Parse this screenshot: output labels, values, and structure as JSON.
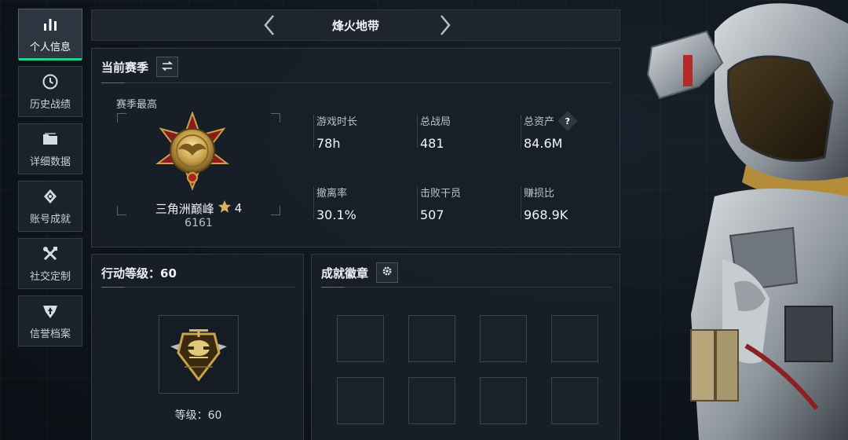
{
  "sidebar": {
    "items": [
      {
        "label": "个人信息",
        "icon": "bar-chart-icon",
        "active": true
      },
      {
        "label": "历史战绩",
        "icon": "clock-icon",
        "active": false
      },
      {
        "label": "详细数据",
        "icon": "folder-icon",
        "active": false
      },
      {
        "label": "账号成就",
        "icon": "diamond-badge-icon",
        "active": false
      },
      {
        "label": "社交定制",
        "icon": "tools-icon",
        "active": false
      },
      {
        "label": "信誉档案",
        "icon": "shield-arrow-icon",
        "active": false
      }
    ]
  },
  "topnav": {
    "title": "烽火地带",
    "prev_icon": "chevron-left-icon",
    "next_icon": "chevron-right-icon"
  },
  "season": {
    "title": "当前赛季",
    "switch_icon": "swap-icon",
    "best_label": "赛季最高",
    "rank_name": "三角洲巅峰",
    "rank_star_icon": "star-icon",
    "rank_stars": "4",
    "rank_score": "6161",
    "stats": [
      {
        "label": "游戏时长",
        "value": "78h"
      },
      {
        "label": "总战局",
        "value": "481"
      },
      {
        "label": "总资产",
        "value": "84.6M",
        "help": "?"
      },
      {
        "label": "撤离率",
        "value": "30.1%"
      },
      {
        "label": "击败干员",
        "value": "507"
      },
      {
        "label": "赚损比",
        "value": "968.9K"
      }
    ]
  },
  "action_level": {
    "title": "行动等级：60",
    "level_text": "等级：60"
  },
  "achievements": {
    "title": "成就徽章",
    "settings_icon": "gear-icon",
    "slot_count": 8
  },
  "colors": {
    "accent": "#1fd48a",
    "background": "#0f151d",
    "panel": "#181f28",
    "gold": "#c9a24a"
  }
}
